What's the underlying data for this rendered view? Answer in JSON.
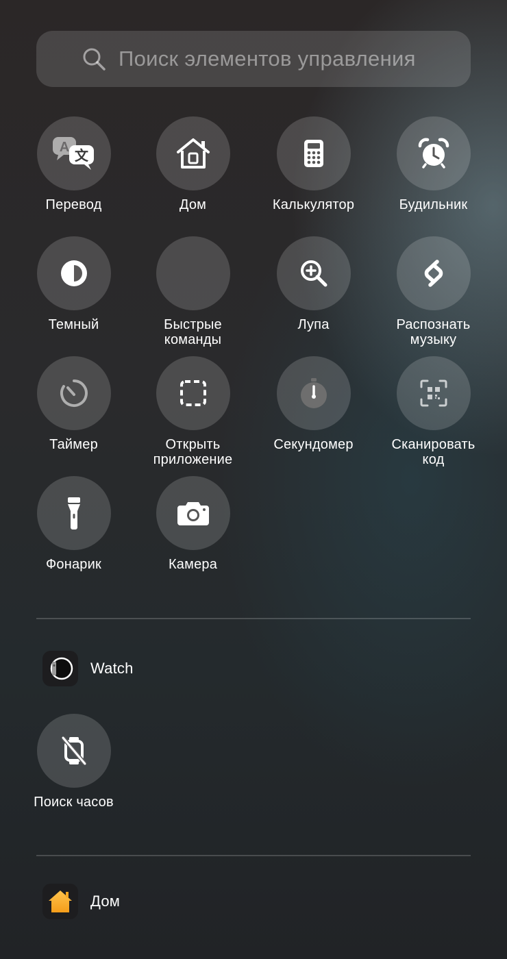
{
  "search": {
    "placeholder": "Поиск элементов управления"
  },
  "controls": [
    {
      "id": "translate",
      "label": "Перевод"
    },
    {
      "id": "home",
      "label": "Дом"
    },
    {
      "id": "calculator",
      "label": "Калькулятор"
    },
    {
      "id": "alarm",
      "label": "Будильник"
    },
    {
      "id": "dark",
      "label": "Темный"
    },
    {
      "id": "shortcuts",
      "label": "Быстрые\nкоманды"
    },
    {
      "id": "magnifier",
      "label": "Лупа"
    },
    {
      "id": "shazam",
      "label": "Распознать\nмузыку"
    },
    {
      "id": "timer",
      "label": "Таймер"
    },
    {
      "id": "open-app",
      "label": "Открыть\nприложение"
    },
    {
      "id": "stopwatch",
      "label": "Секундомер"
    },
    {
      "id": "scan-code",
      "label": "Сканировать\nкод"
    },
    {
      "id": "flashlight",
      "label": "Фонарик"
    },
    {
      "id": "camera",
      "label": "Камера"
    }
  ],
  "sections": [
    {
      "title": "Watch",
      "icon": "watch-app-icon",
      "controls": [
        {
          "id": "find-watch",
          "label": "Поиск часов"
        }
      ]
    },
    {
      "title": "Дом",
      "icon": "home-app-icon"
    }
  ],
  "colors": {
    "home_accent": "#f7a823",
    "tile_bg": "rgba(255,255,255,0.16)"
  }
}
